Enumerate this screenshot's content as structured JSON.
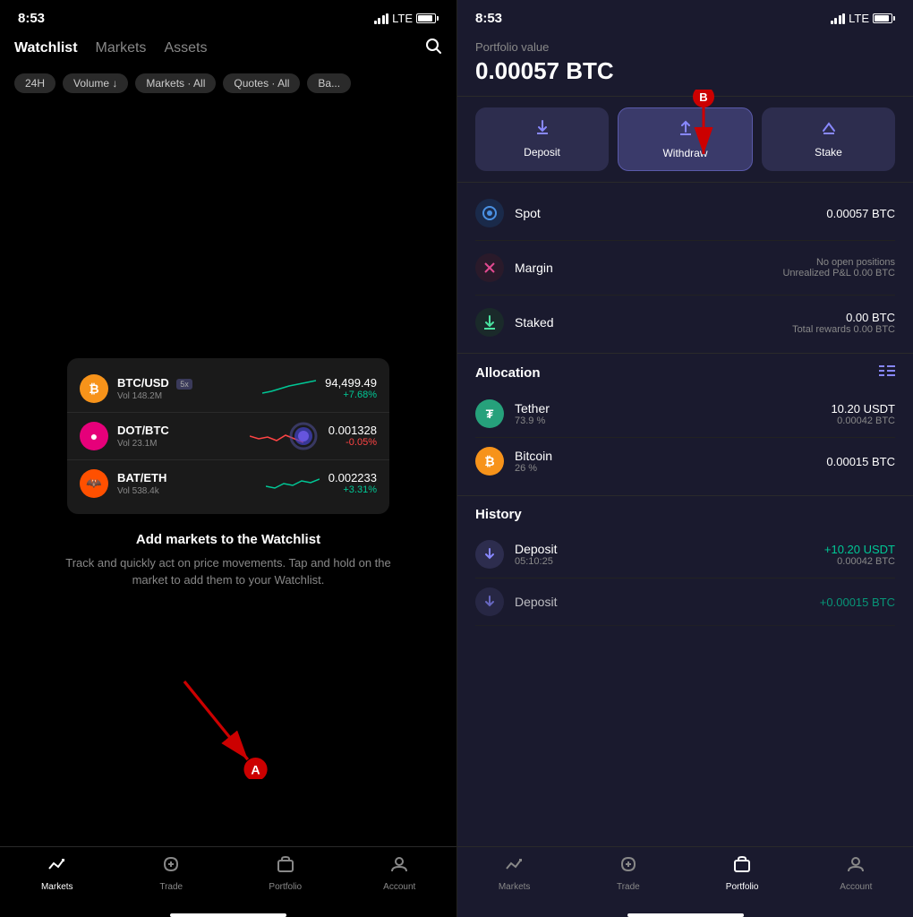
{
  "left_phone": {
    "status_bar": {
      "time": "8:53",
      "signal": "LTE"
    },
    "nav": {
      "tabs": [
        {
          "label": "Watchlist",
          "active": true
        },
        {
          "label": "Markets",
          "active": false
        },
        {
          "label": "Assets",
          "active": false
        }
      ],
      "search_icon": "search"
    },
    "filters": [
      {
        "label": "24H"
      },
      {
        "label": "Volume ↓"
      },
      {
        "label": "Markets · All"
      },
      {
        "label": "Quotes · All"
      },
      {
        "label": "Ba..."
      }
    ],
    "markets": [
      {
        "pair": "BTC/USD",
        "badge": "5x",
        "vol": "Vol 148.2M",
        "price": "94,499.49",
        "change": "+7.68%",
        "direction": "up",
        "coin": "BTC"
      },
      {
        "pair": "DOT/BTC",
        "badge": "",
        "vol": "Vol 23.1M",
        "price": "0.001328",
        "change": "-0.05%",
        "direction": "down",
        "coin": "DOT"
      },
      {
        "pair": "BAT/ETH",
        "badge": "",
        "vol": "Vol 538.4k",
        "price": "0.002233",
        "change": "+3.31%",
        "direction": "up",
        "coin": "BAT"
      }
    ],
    "watchlist_message": {
      "title": "Add markets to the Watchlist",
      "desc": "Track and quickly act on price movements. Tap and hold on the market to add them to your Watchlist."
    },
    "bottom_nav": [
      {
        "label": "Markets",
        "active": true,
        "icon": "📈"
      },
      {
        "label": "Trade",
        "active": false,
        "icon": "🔄"
      },
      {
        "label": "Portfolio",
        "active": false,
        "icon": "🗂"
      },
      {
        "label": "Account",
        "active": false,
        "icon": "👤"
      }
    ],
    "arrow_a_label": "A"
  },
  "right_phone": {
    "status_bar": {
      "time": "8:53",
      "signal": "LTE"
    },
    "portfolio": {
      "label": "Portfolio value",
      "value": "0.00057 BTC"
    },
    "actions": [
      {
        "label": "Deposit",
        "icon": "⬇",
        "active": false
      },
      {
        "label": "Withdraw",
        "icon": "⬆",
        "active": true
      },
      {
        "label": "Stake",
        "icon": "📥",
        "active": false
      }
    ],
    "accounts": [
      {
        "icon": "⊙",
        "icon_color": "#4a90e2",
        "label": "Spot",
        "primary": "0.00057 BTC",
        "secondary": ""
      },
      {
        "icon": "✕",
        "icon_color": "#e24a90",
        "label": "Margin",
        "primary": "No open positions",
        "secondary": "Unrealized P&L 0.00 BTC"
      },
      {
        "icon": "⬇",
        "icon_color": "#4ae2a0",
        "label": "Staked",
        "primary": "0.00 BTC",
        "secondary": "Total rewards 0.00 BTC"
      }
    ],
    "allocation": {
      "title": "Allocation",
      "items": [
        {
          "name": "Tether",
          "pct": "73.9 %",
          "primary": "10.20 USDT",
          "secondary": "0.00042 BTC",
          "coin": "USDT"
        },
        {
          "name": "Bitcoin",
          "pct": "26 %",
          "primary": "0.00015 BTC",
          "secondary": "",
          "coin": "BTC"
        }
      ]
    },
    "history": {
      "title": "History",
      "items": [
        {
          "type": "Deposit",
          "time": "05:10:25",
          "primary": "+10.20  USDT",
          "secondary": "0.00042 BTC"
        },
        {
          "type": "Deposit",
          "time": "",
          "primary": "+0.00015 BTC",
          "secondary": ""
        }
      ]
    },
    "bottom_nav": [
      {
        "label": "Markets",
        "active": false,
        "icon": "📈"
      },
      {
        "label": "Trade",
        "active": false,
        "icon": "🔄"
      },
      {
        "label": "Portfolio",
        "active": true,
        "icon": "🗂"
      },
      {
        "label": "Account",
        "active": false,
        "icon": "👤"
      }
    ],
    "arrow_b_label": "B"
  }
}
